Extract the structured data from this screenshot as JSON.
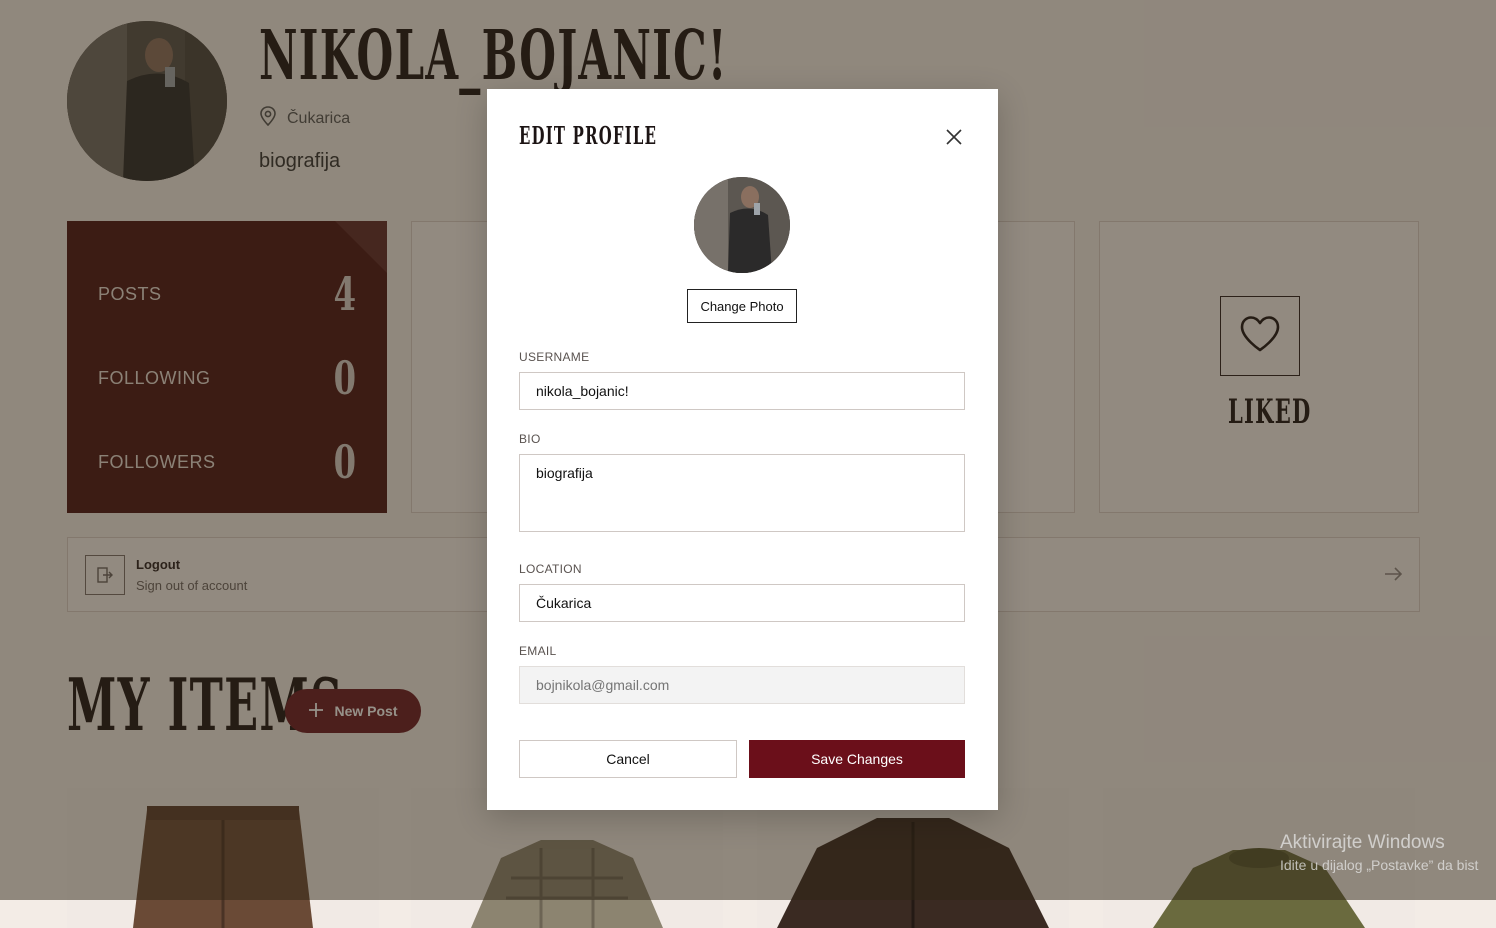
{
  "profile": {
    "name": "NIKOLA_BOJANIC!",
    "location": "Čukarica",
    "bio": "biografija"
  },
  "stats": [
    {
      "label": "POSTS",
      "value": "4"
    },
    {
      "label": "FOLLOWING",
      "value": "0"
    },
    {
      "label": "FOLLOWERS",
      "value": "0"
    }
  ],
  "liked_card": {
    "label": "LIKED",
    "icon": "heart-icon"
  },
  "logout": {
    "title": "Logout",
    "subtitle": "Sign out of account",
    "icon": "logout-icon"
  },
  "items_section": {
    "title": "MY ITEMS",
    "new_post_label": "New Post"
  },
  "modal": {
    "title": "EDIT PROFILE",
    "change_photo_label": "Change Photo",
    "username_label": "USERNAME",
    "username_value": "nikola_bojanic!",
    "bio_label": "BIO",
    "bio_value": "biografija",
    "location_label": "LOCATION",
    "location_value": "Čukarica",
    "email_label": "EMAIL",
    "email_placeholder": "bojnikola@gmail.com",
    "cancel_label": "Cancel",
    "save_label": "Save Changes"
  },
  "windows_watermark": {
    "title": "Aktivirajte Windows",
    "subtitle": "Idite u dijalog „Postavke” da bist"
  },
  "colors": {
    "accent": "#6b0f1a",
    "stats_bg": "#4a1414",
    "page_bg": "#f3ece6"
  }
}
